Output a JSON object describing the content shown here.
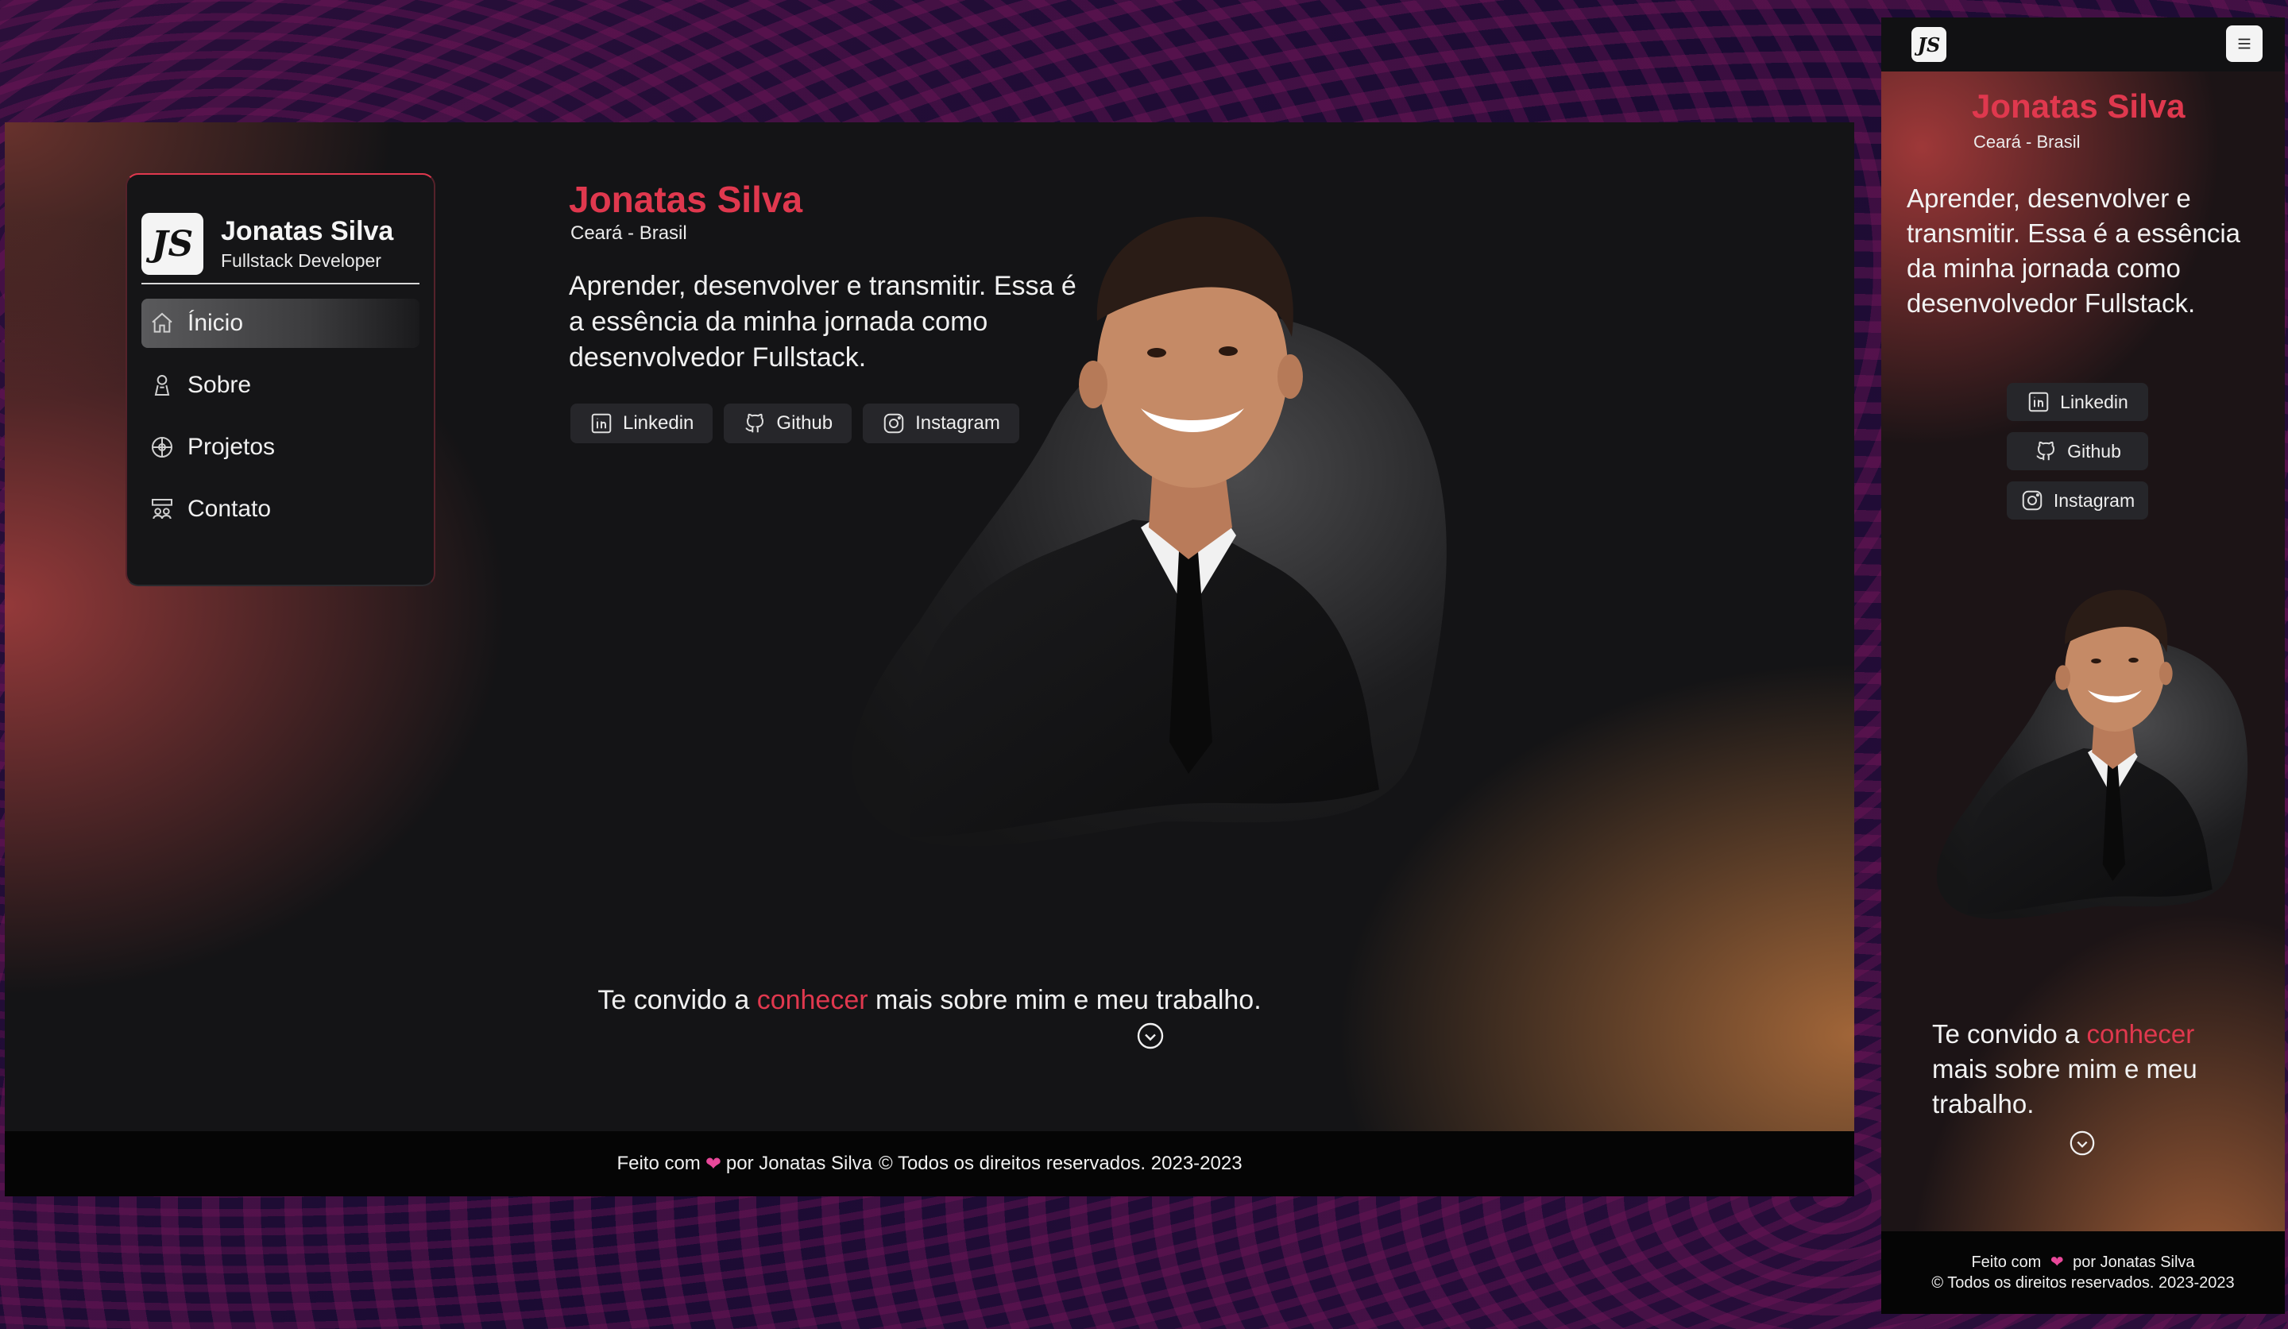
{
  "brand": {
    "logo_text": "JS",
    "name": "Jonatas Silva",
    "role": "Fullstack Developer"
  },
  "nav": {
    "items": [
      {
        "label": "Ínicio",
        "icon": "home-icon",
        "active": true
      },
      {
        "label": "Sobre",
        "icon": "person-icon",
        "active": false
      },
      {
        "label": "Projetos",
        "icon": "projects-icon",
        "active": false
      },
      {
        "label": "Contato",
        "icon": "contact-icon",
        "active": false
      }
    ]
  },
  "hero": {
    "title": "Jonatas Silva",
    "location": "Ceará - Brasil",
    "intro": "Aprender, desenvolver e transmitir. Essa é a essência da minha jornada como desenvolvedor Fullstack."
  },
  "socials": {
    "linkedin": "Linkedin",
    "github": "Github",
    "instagram": "Instagram"
  },
  "invite": {
    "before": "Te convido a ",
    "highlight": "conhecer",
    "after": " mais sobre mim e meu trabalho."
  },
  "footer": {
    "made_with": "Feito com",
    "by": "por Jonatas Silva",
    "rights": "© Todos os direitos reservados. 2023-2023"
  },
  "colors": {
    "accent": "#e0384e",
    "heart": "#e8489a"
  }
}
